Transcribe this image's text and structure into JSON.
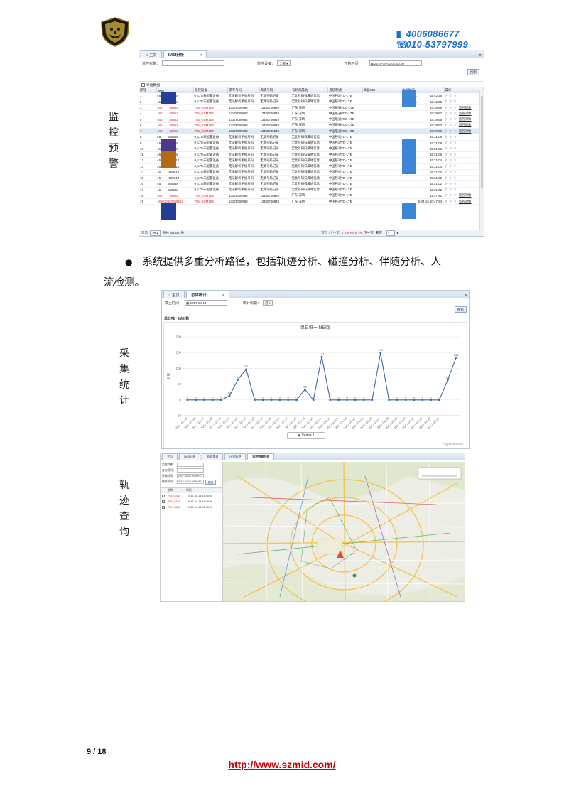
{
  "header": {
    "phone1": "4006086677",
    "phone2": "010-53797999"
  },
  "side_labels": {
    "monitor": [
      "监",
      "控",
      "预",
      "警"
    ],
    "stats": [
      "采",
      "集",
      "统",
      "计"
    ],
    "track": [
      "轨",
      "迹",
      "查",
      "询"
    ]
  },
  "imsi_shot": {
    "tabs": [
      "主页",
      "IMSI分析"
    ],
    "filter": {
      "target_label": "监控对象：",
      "device_label": "监控设备：",
      "device_value": "全部",
      "start_label": "开始时间：",
      "start_value": "2016-04-01 00:00:00",
      "search_button": "搜索"
    },
    "export_label": "导出数据",
    "columns": [
      "序号",
      "IMSI",
      "监控设备",
      "参考号码",
      "真实号码",
      "号码归属地",
      "通信制式",
      "关联MEI",
      "上报时间",
      "操作"
    ],
    "rows": [
      {
        "n": "1",
        "imsi": "46",
        "imsi2": "589918",
        "dev": "0_LTE未配置设备",
        "ref": "无法解析手机号码",
        "real": "无此号码记录",
        "loc": "无此号码归属地信息",
        "net": "中国移动TD-LTE",
        "time": "201",
        "time2": "15:42:36",
        "mon": "",
        "red": false
      },
      {
        "n": "2",
        "imsi": "46",
        "imsi2": "589918",
        "dev": "0_LTE未配置设备",
        "ref": "无法解析手机号码",
        "real": "无此号码记录",
        "loc": "无此号码归属地信息",
        "net": "中国移动TD-LTE",
        "time": "201",
        "time2": "15:42:36",
        "mon": "",
        "red": false
      },
      {
        "n": "3",
        "imsi": "460",
        "imsi2": "49962",
        "dev": "755_GSM109",
        "ref": "13178089962",
        "real": "13480760840",
        "loc": "广东 深圳",
        "net": "中国联通FDD-LTE",
        "time": "",
        "time2": "15:39:59",
        "mon": "监控对象",
        "red": true
      },
      {
        "n": "4",
        "imsi": "460",
        "imsi2": "49962",
        "dev": "755_GSM109",
        "ref": "13178089962",
        "real": "13480760840",
        "loc": "广东 深圳",
        "net": "中国联通FDD-LTE",
        "time": "",
        "time2": "15:39:57",
        "mon": "监控对象",
        "red": true
      },
      {
        "n": "5",
        "imsi": "460",
        "imsi2": "49962",
        "dev": "755_GSM109",
        "ref": "13178089962",
        "real": "13480760840",
        "loc": "广东 深圳",
        "net": "中国联通FDD-LTE",
        "time": "",
        "time2": "15:39:55",
        "mon": "监控对象",
        "red": true
      },
      {
        "n": "6",
        "imsi": "460",
        "imsi2": "49962",
        "dev": "755_GSM109",
        "ref": "13178089962",
        "real": "13480760840",
        "loc": "广东 深圳",
        "net": "中国联通FDD-LTE",
        "time": "",
        "time2": "15:39:53",
        "mon": "监控对象",
        "red": true
      },
      {
        "n": "7",
        "imsi": "460",
        "imsi2": "49962",
        "dev": "755_GSM109",
        "ref": "13178089962",
        "real": "13480760840",
        "loc": "广东 深圳",
        "net": "中国联通FDD-LTE",
        "time": "",
        "time2": "15:39:53",
        "mon": "监控对象",
        "red": true
      },
      {
        "n": "8",
        "imsi": "46",
        "imsi2": "589918",
        "dev": "0_LTE未配置设备",
        "ref": "无法解析手机号码",
        "real": "无此号码记录",
        "loc": "无此号码归属地信息",
        "net": "中国移动TD-LTE",
        "time": "",
        "time2": "15:31:08",
        "mon": "",
        "red": false
      },
      {
        "n": "9",
        "imsi": "46",
        "imsi2": "589918",
        "dev": "0_LTE未配置设备",
        "ref": "无法解析手机号码",
        "real": "无此号码记录",
        "loc": "无此号码归属地信息",
        "net": "中国移动TD-LTE",
        "time": "",
        "time2": "15:31:08",
        "mon": "",
        "red": false
      },
      {
        "n": "10",
        "imsi": "46",
        "imsi2": "589918",
        "dev": "0_LTE未配置设备",
        "ref": "无法解析手机号码",
        "real": "无此号码记录",
        "loc": "无此号码归属地信息",
        "net": "中国移动TD-LTE",
        "time": "",
        "time2": "15:31:06",
        "mon": "",
        "red": false
      },
      {
        "n": "11",
        "imsi": "46",
        "imsi2": "589918",
        "dev": "0_LTE未配置设备",
        "ref": "无法解析手机号码",
        "real": "无此号码记录",
        "loc": "无此号码归属地信息",
        "net": "中国移动TD-LTE",
        "time": "",
        "time2": "15:31:06",
        "mon": "",
        "red": false
      },
      {
        "n": "12",
        "imsi": "46‹",
        "imsi2": "589918",
        "dev": "0_LTE未配置设备",
        "ref": "无法解析手机号码",
        "real": "无此号码记录",
        "loc": "无此号码归属地信息",
        "net": "中国移动TD-LTE",
        "time": "",
        "time2": "15:31:04",
        "mon": "",
        "red": false
      },
      {
        "n": "13",
        "imsi": "46‹",
        "imsi2": "589918",
        "dev": "0_LTE未配置设备",
        "ref": "无法解析手机号码",
        "real": "无此号码记录",
        "loc": "无此号码归属地信息",
        "net": "中国移动TD-LTE",
        "time": "",
        "time2": "15:31:04",
        "mon": "",
        "red": false
      },
      {
        "n": "14",
        "imsi": "46‹",
        "imsi2": "589918",
        "dev": "0_LTE未配置设备",
        "ref": "无法解析手机号码",
        "real": "无此号码记录",
        "loc": "无此号码归属地信息",
        "net": "中国移动TD-LTE",
        "time": "",
        "time2": "15:31:02",
        "mon": "",
        "red": false
      },
      {
        "n": "15",
        "imsi": "46‹",
        "imsi2": "589918",
        "dev": "0_LTE未配置设备",
        "ref": "无法解析手机号码",
        "real": "无此号码记录",
        "loc": "无此号码归属地信息",
        "net": "中国移动TD-LTE",
        "time": "",
        "time2": "15:31:02",
        "mon": "",
        "red": false
      },
      {
        "n": "16",
        "imsi": "46",
        "imsi2": "589918",
        "dev": "0_LTE未配置设备",
        "ref": "无法解析手机号码",
        "real": "无此号码记录",
        "loc": "无此号码归属地信息",
        "net": "中国移动TD-LTE",
        "time": "",
        "time2": "15:31:02",
        "mon": "",
        "red": false
      },
      {
        "n": "17",
        "imsi": "46",
        "imsi2": "589918",
        "dev": "0_LTE未配置设备",
        "ref": "无法解析手机号码",
        "real": "无此号码记录",
        "loc": "无此号码归属地信息",
        "net": "中国移动TD-LTE",
        "time": "",
        "time2": "15:31:02",
        "mon": "",
        "red": false
      },
      {
        "n": "18",
        "imsi": "460",
        "imsi2": "49962",
        "dev": "755_GSM109",
        "ref": "13178089962",
        "real": "13480760840",
        "loc": "广东 深圳",
        "net": "中国移动TD-LTE",
        "time": "",
        "time2": "12:47:41",
        "mon": "监控对象",
        "red": true
      },
      {
        "n": "19",
        "imsi": "460010557949962",
        "imsi2": "",
        "dev": "755_GSM109",
        "ref": "13178089962",
        "real": "13480760840",
        "loc": "广东 深圳",
        "net": "中国移动TD-LTE",
        "time": "",
        "time2": "6-04-13 10:47:24",
        "mon": "监控对象",
        "red": true
      }
    ],
    "pager": {
      "show_label": "显示",
      "page_size": "20",
      "total": "总共 650047条",
      "nav_left": "首页 ‹上一页",
      "pages": "1 2 6 7 8 9 10",
      "nav_right": "下一页› 末页",
      "page_input": "1"
    }
  },
  "bullet": {
    "symbol": "●",
    "line1": "系统提供多重分析路径，包括轨迹分析、碰撞分析、伴随分析、人",
    "line2": "流检测。"
  },
  "stats_shot": {
    "tabs": [
      "主页",
      "总体统计"
    ],
    "deadline_label": "截止时间：",
    "deadline_value": "2017-04-14",
    "period_label": "统计周期：",
    "period_value": "月",
    "search_button": "搜索",
    "panel_title": "单日唯一IMEI数",
    "credit": "Highcharts.com"
  },
  "chart_data": {
    "type": "line",
    "title": "单日唯一IMEI数",
    "ylabel": "数量",
    "ylim": [
      -50,
      200
    ],
    "yticks": [
      -50,
      0,
      50,
      100,
      150,
      200
    ],
    "categories": [
      "2017-03-15",
      "2017-03-16",
      "2017-03-17",
      "2017-03-18",
      "2017-03-19",
      "2017-03-20",
      "2017-03-21",
      "2017-03-22",
      "2017-03-23",
      "2017-03-24",
      "2017-03-25",
      "2017-03-26",
      "2017-03-27",
      "2017-03-28",
      "2017-03-29",
      "2017-03-30",
      "2017-03-31",
      "2017-04-01",
      "2017-04-02",
      "2017-04-03",
      "2017-04-04",
      "2017-04-05",
      "2017-04-06",
      "2017-04-07",
      "2017-04-08",
      "2017-04-09",
      "2017-04-10",
      "2017-04-11",
      "2017-04-12",
      "2017-04-13",
      "2017-04-14"
    ],
    "series": [
      {
        "name": "Series 1",
        "values": [
          0,
          0,
          0,
          0,
          0,
          13,
          64,
          97,
          0,
          0,
          0,
          0,
          0,
          0,
          33,
          0,
          137,
          0,
          0,
          0,
          0,
          0,
          0,
          149,
          0,
          0,
          0,
          0,
          0,
          0,
          0,
          63,
          134
        ]
      }
    ],
    "legend": "bottom-center"
  },
  "track_shot": {
    "tabs": [
      "主页",
      "IMSI分析",
      "轨迹查询",
      "历史轨迹",
      "监控数据列表"
    ],
    "fields": [
      {
        "label": "监控对象：",
        "value": ""
      },
      {
        "label": "查询号码：",
        "value": ""
      },
      {
        "label": "开始时间：",
        "value": "2017-04-14 00:00:00"
      },
      {
        "label": "结束时间：",
        "value": "2017-04-14 23:59:59"
      }
    ],
    "search_button": "搜索",
    "list_header": [
      "名称",
      "时间"
    ],
    "list_rows": [
      {
        "name": "755_GSM",
        "time": "2017-04-14 15:40:28"
      },
      {
        "name": "755_GSM",
        "time": "2017-04-14 15:40:28"
      },
      {
        "name": "755_GSM",
        "time": "2017-04-14 00:46:28"
      }
    ]
  },
  "footer": {
    "page": "9 / 18",
    "url": "http://www.szmid.com/"
  },
  "colors": {
    "phone": "#1a6fd6",
    "red_text": "#d22",
    "mask_blue": "#2a3f9a",
    "mask_light": "#3d86d6",
    "mask_orange": "#b36a12",
    "line": "#3b6ba5"
  }
}
